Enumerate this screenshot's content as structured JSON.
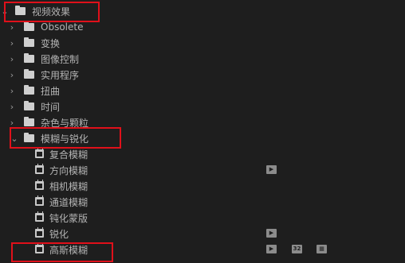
{
  "tree": {
    "root": {
      "label": "视频效果"
    },
    "folders": [
      {
        "label": "Obsolete"
      },
      {
        "label": "变换"
      },
      {
        "label": "图像控制"
      },
      {
        "label": "实用程序"
      },
      {
        "label": "扭曲"
      },
      {
        "label": "时间"
      },
      {
        "label": "杂色与颗粒"
      },
      {
        "label": "模糊与锐化"
      }
    ],
    "effects": [
      {
        "label": "复合模糊",
        "badges": []
      },
      {
        "label": "方向模糊",
        "badges": [
          "accelerated-badge-icon"
        ]
      },
      {
        "label": "相机模糊",
        "badges": []
      },
      {
        "label": "通道模糊",
        "badges": []
      },
      {
        "label": "钝化蒙版",
        "badges": []
      },
      {
        "label": "锐化",
        "badges": [
          "accelerated-badge-icon"
        ]
      },
      {
        "label": "高斯模糊",
        "badges": [
          "accelerated-badge-icon",
          "32bit-badge-icon",
          "yuv-badge-icon"
        ]
      }
    ],
    "badge_text": {
      "bit32": "32"
    }
  },
  "colors": {
    "background": "#1e1e1e",
    "text": "#b4b4b4",
    "highlight": "#e0101a"
  }
}
